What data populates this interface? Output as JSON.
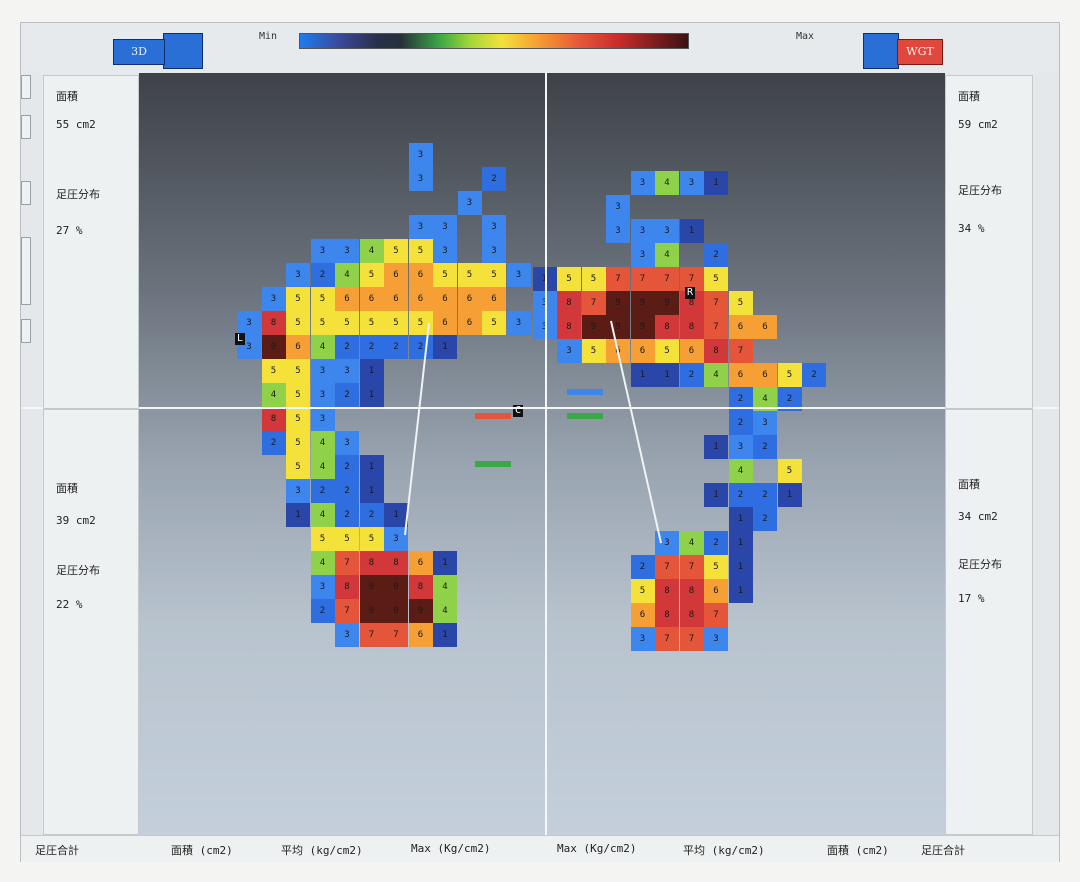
{
  "toolbar": {
    "btn_3d_label": "3D",
    "btn_wgt_label": "WGT",
    "scale_min": "Min",
    "scale_max": "Max"
  },
  "panels": {
    "left_top": {
      "area_label": "面積",
      "area_value": "55 cm2",
      "dist_label": "足圧分布",
      "dist_value": "27 %"
    },
    "right_top": {
      "area_label": "面積",
      "area_value": "59 cm2",
      "dist_label": "足圧分布",
      "dist_value": "34 %"
    },
    "left_bottom": {
      "area_label": "面積",
      "area_value": "39 cm2",
      "dist_label": "足圧分布",
      "dist_value": "22 %"
    },
    "right_bottom": {
      "area_label": "面積",
      "area_value": "34 cm2",
      "dist_label": "足圧分布",
      "dist_value": "17 %"
    }
  },
  "markers": {
    "left": "L",
    "right": "R",
    "center": "C"
  },
  "bottom_bar": {
    "total_left": "足圧合計",
    "area_left": "面積 (cm2)",
    "avg_left": "平均 (kg/cm2)",
    "max_left": "Max (Kg/cm2)",
    "max_right": "Max (Kg/cm2)",
    "avg_right": "平均 (kg/cm2)",
    "area_right": "面積 (cm2)",
    "total_right": "足圧合計"
  },
  "colors": {
    "0": "#2f3440",
    "1": "#2a46a8",
    "2": "#2f6ee0",
    "3": "#3d86ee",
    "4": "#8fd24a",
    "5": "#f4e23a",
    "6": "#f59f35",
    "7": "#e5553a",
    "8": "#d2383a",
    "9": "#5a1c14"
  },
  "heatmap": {
    "left_foot": [
      "...........3.....",
      "...........3..2..",
      ".............3...",
      "...........33.3..",
      ".......334553.3..",
      "......3245665553.",
      ".....3556666666..",
      "....385555556653.",
      "....396422221....",
      ".....55331.......",
      ".....45321.......",
      ".....853.........",
      ".....2543........",
      "......5421.......",
      "......3221.......",
      "......14221......",
      ".......5553......",
      ".......478861....",
      ".......389984....",
      ".......279994....",
      "........37761...."
    ],
    "right_foot": [
      "...........3431....",
      "..........3........",
      "..........3331.....",
      "...........34 2....",
      ".......15577775....",
      ".......387999875...",
      ".......3899988766..",
      "........35665687...",
      "...........11246652",
      "...............242.",
      "...............23..",
      "..............132..",
      "...............4 5.",
      "..............1221.",
      "...............12..",
      "............3421...",
      "...........27751...",
      "...........58861...",
      "...........6887....",
      "...........3773...."
    ]
  }
}
